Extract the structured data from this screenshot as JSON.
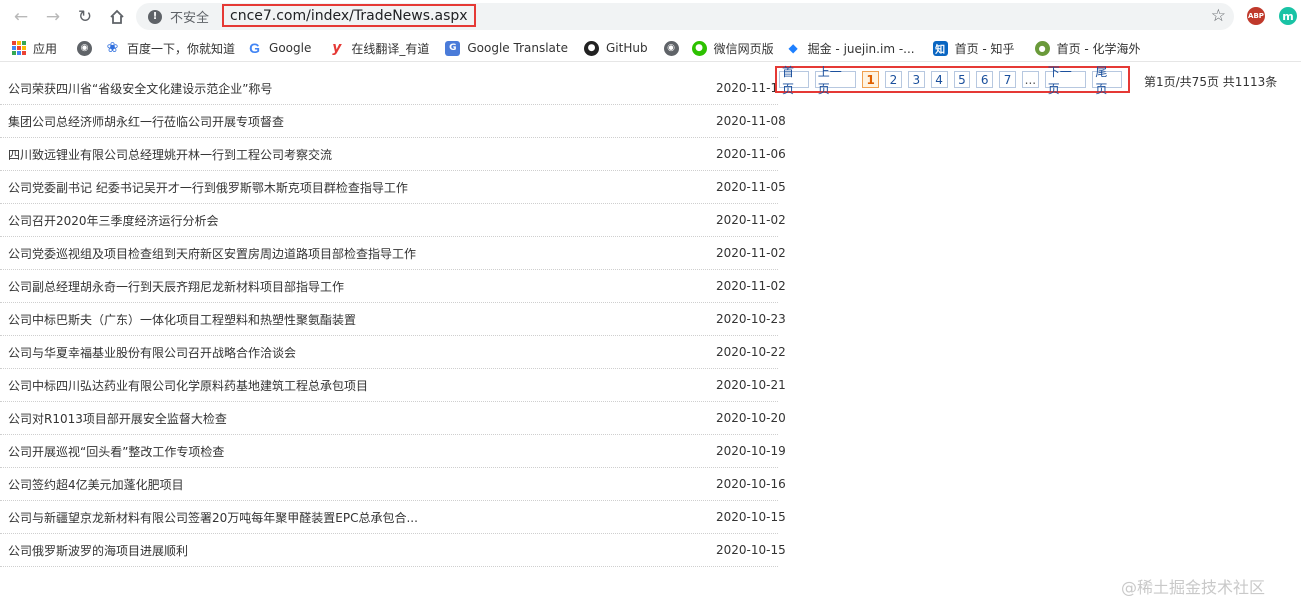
{
  "browser": {
    "insecure_label": "不安全",
    "url": "cnce7.com/index/TradeNews.aspx",
    "ext_abp_label": "ABP",
    "ext_m_label": "m"
  },
  "bookmarks": [
    {
      "label": "应用",
      "icon": "apps-icon"
    },
    {
      "label": "",
      "icon": "globe-icon"
    },
    {
      "label": "百度一下，你就知道",
      "icon": "baidu-icon"
    },
    {
      "label": "Google",
      "icon": "google-icon"
    },
    {
      "label": "在线翻译_有道",
      "icon": "youdao-icon"
    },
    {
      "label": "Google Translate",
      "icon": "google-translate-icon"
    },
    {
      "label": "GitHub",
      "icon": "github-icon"
    },
    {
      "label": "",
      "icon": "globe-icon"
    },
    {
      "label": "微信网页版",
      "icon": "wechat-icon"
    },
    {
      "label": "掘金 - juejin.im -...",
      "icon": "juejin-icon"
    },
    {
      "label": "首页 - 知乎",
      "icon": "zhihu-icon"
    },
    {
      "label": "首页 - 化学海外",
      "icon": "chem-icon"
    }
  ],
  "news": [
    {
      "title": "公司荣获四川省“省级安全文化建设示范企业”称号",
      "date": "2020-11-10"
    },
    {
      "title": "集团公司总经济师胡永红一行莅临公司开展专项督查",
      "date": "2020-11-08"
    },
    {
      "title": "四川致远锂业有限公司总经理姚开林一行到工程公司考察交流",
      "date": "2020-11-06"
    },
    {
      "title": "公司党委副书记 纪委书记吴开才一行到俄罗斯鄂木斯克项目群检查指导工作",
      "date": "2020-11-05"
    },
    {
      "title": "公司召开2020年三季度经济运行分析会",
      "date": "2020-11-02"
    },
    {
      "title": "公司党委巡视组及项目检查组到天府新区安置房周边道路项目部检查指导工作",
      "date": "2020-11-02"
    },
    {
      "title": "公司副总经理胡永奇一行到天辰齐翔尼龙新材料项目部指导工作",
      "date": "2020-11-02"
    },
    {
      "title": "公司中标巴斯夫（广东）一体化项目工程塑料和热塑性聚氨酯装置",
      "date": "2020-10-23"
    },
    {
      "title": "公司与华夏幸福基业股份有限公司召开战略合作洽谈会",
      "date": "2020-10-22"
    },
    {
      "title": "公司中标四川弘达药业有限公司化学原料药基地建筑工程总承包项目",
      "date": "2020-10-21"
    },
    {
      "title": "公司对R1013项目部开展安全监督大检查",
      "date": "2020-10-20"
    },
    {
      "title": "公司开展巡视“回头看”整改工作专项检查",
      "date": "2020-10-19"
    },
    {
      "title": "公司签约超4亿美元加蓬化肥项目",
      "date": "2020-10-16"
    },
    {
      "title": "公司与新疆望京龙新材料有限公司签署20万吨每年聚甲醛装置EPC总承包合...",
      "date": "2020-10-15"
    },
    {
      "title": "公司俄罗斯波罗的海项目进展顺利",
      "date": "2020-10-15"
    }
  ],
  "pager": {
    "first": "首页",
    "prev": "上一页",
    "pages": [
      "1",
      "2",
      "3",
      "4",
      "5",
      "6",
      "7"
    ],
    "ellipsis": "...",
    "next": "下一页",
    "last": "尾页",
    "current_page": 1,
    "info": "第1页/共75页 共1113条"
  },
  "watermark": "@稀土掘金技术社区"
}
